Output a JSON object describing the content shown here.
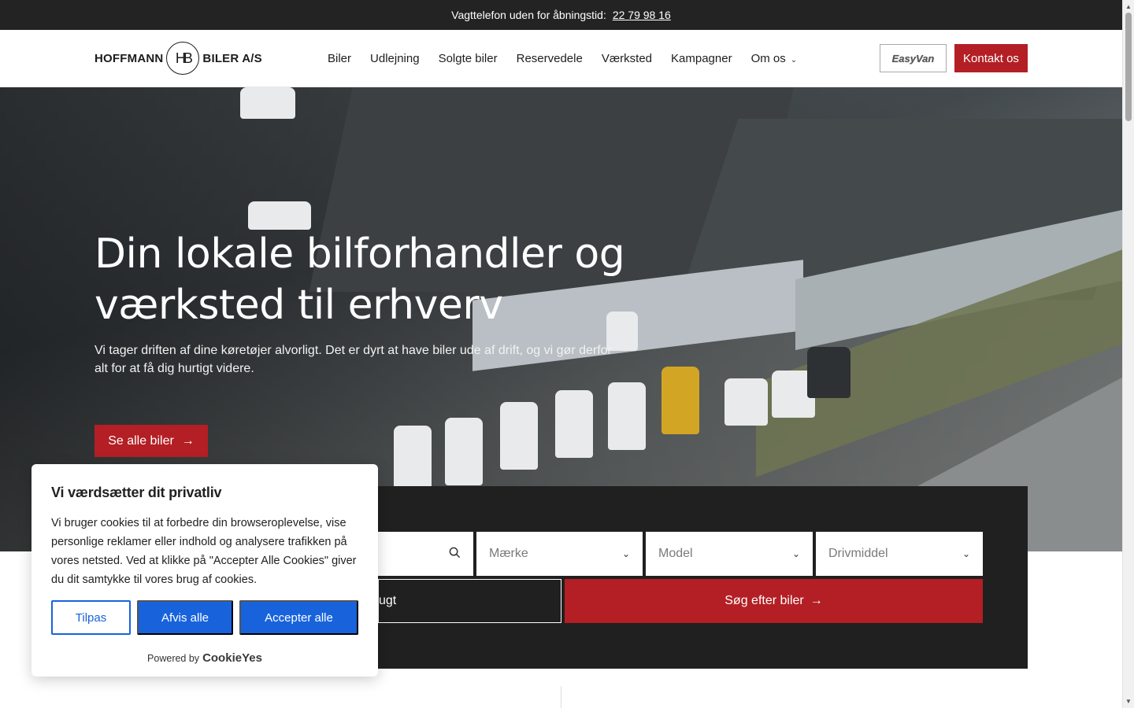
{
  "topbar": {
    "text": "Vagttelefon uden for åbningstid:",
    "phone": "22 79 98 16"
  },
  "header": {
    "logo_left": "HOFFMANN",
    "logo_mark": "HB",
    "logo_right": "BILER A/S",
    "nav": [
      "Biler",
      "Udlejning",
      "Solgte biler",
      "Reservedele",
      "Værksted",
      "Kampagner",
      "Om os"
    ],
    "partner_badge": "EasyVan",
    "contact_label": "Kontakt os"
  },
  "hero": {
    "title": "Din lokale bilforhandler og værksted til erhverv",
    "subtitle": "Vi tager driften af dine køretøjer alvorligt. Det er dyrt at have biler ude af drift, og vi gør derfor alt for at få dig hurtigt videre.",
    "cta_label": "Se alle biler",
    "cta_arrow": "→"
  },
  "search": {
    "brand_placeholder": "Mærke",
    "model_placeholder": "Model",
    "fuel_placeholder": "Drivmiddel",
    "condition_partial": "ugt",
    "submit_label": "Søg efter biler",
    "submit_arrow": "→"
  },
  "cookie": {
    "title": "Vi værdsætter dit privatliv",
    "body": "Vi bruger cookies til at forbedre din browseroplevelse, vise personlige reklamer eller indhold og analysere trafikken på vores netsted. Ved at klikke på \"Accepter Alle Cookies\" giver du dit samtykke til vores brug af cookies.",
    "customize": "Tilpas",
    "reject": "Afvis alle",
    "accept": "Accepter alle",
    "powered_by": "Powered by",
    "brand": "CookieYes"
  },
  "colors": {
    "brand_red": "#b31f24",
    "cookie_blue": "#1863dc",
    "dark_bg": "#202020"
  },
  "icons": {
    "search": "search-icon",
    "chevron": "chevron-down-icon",
    "arrow": "arrow-right-icon"
  }
}
